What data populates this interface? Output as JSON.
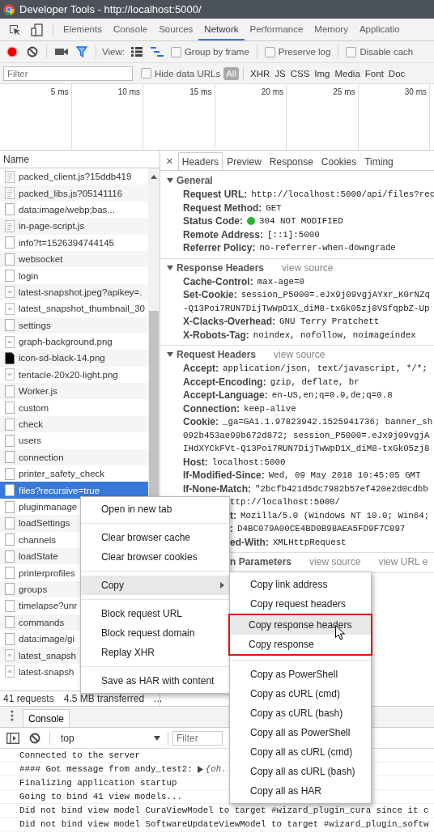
{
  "window": {
    "title": "Developer Tools - http://localhost:5000/"
  },
  "panel_tabs": [
    {
      "label": "Elements",
      "selected": false
    },
    {
      "label": "Console",
      "selected": false
    },
    {
      "label": "Sources",
      "selected": false
    },
    {
      "label": "Network",
      "selected": true
    },
    {
      "label": "Performance",
      "selected": false
    },
    {
      "label": "Memory",
      "selected": false
    },
    {
      "label": "Applicatio",
      "selected": false
    }
  ],
  "toolbar": {
    "recording": true,
    "filter_shown": true,
    "view_label": "View:",
    "large_rows": false,
    "overview": true,
    "options": [
      {
        "label": "Group by frame",
        "checked": false
      },
      {
        "label": "Preserve log",
        "checked": false
      },
      {
        "label": "Disable cach",
        "checked": false
      }
    ]
  },
  "filter_bar": {
    "placeholder": "Filter",
    "hide_data_urls": {
      "label": "Hide data URLs",
      "checked": false
    },
    "types": [
      {
        "label": "All",
        "selected": true
      },
      {
        "label": "XHR",
        "selected": false
      },
      {
        "label": "JS",
        "selected": false
      },
      {
        "label": "CSS",
        "selected": false
      },
      {
        "label": "Img",
        "selected": false
      },
      {
        "label": "Media",
        "selected": false
      },
      {
        "label": "Font",
        "selected": false
      },
      {
        "label": "Doc",
        "selected": false
      }
    ]
  },
  "timeline": {
    "ticks": [
      "5 ms",
      "10 ms",
      "15 ms",
      "20 ms",
      "25 ms",
      "30 ms"
    ]
  },
  "requests": {
    "column": "Name",
    "rows": [
      {
        "name": "packed_client.js?15ddb419",
        "kind": "script",
        "selected": false
      },
      {
        "name": "packed_libs.js?05141116",
        "kind": "script",
        "selected": false
      },
      {
        "name": "data:image/webp;bas...",
        "kind": "blank",
        "selected": false
      },
      {
        "name": "in-page-script.js",
        "kind": "script",
        "selected": false
      },
      {
        "name": "info?t=1526394744145",
        "kind": "blank",
        "selected": false
      },
      {
        "name": "websocket",
        "kind": "blank",
        "selected": false
      },
      {
        "name": "login",
        "kind": "blank",
        "selected": false
      },
      {
        "name": "latest-snapshot.jpeg?apikey=.",
        "kind": "image",
        "selected": false
      },
      {
        "name": "latest_snapshot_thumbnail_30",
        "kind": "image",
        "selected": false
      },
      {
        "name": "settings",
        "kind": "blank",
        "selected": false
      },
      {
        "name": "graph-background.png",
        "kind": "image",
        "selected": false
      },
      {
        "name": "icon-sd-black-14.png",
        "kind": "solid",
        "selected": false
      },
      {
        "name": "tentacle-20x20-light.png",
        "kind": "image",
        "selected": false
      },
      {
        "name": "Worker.js",
        "kind": "blank",
        "selected": false
      },
      {
        "name": "custom",
        "kind": "blank",
        "selected": false
      },
      {
        "name": "check",
        "kind": "blank",
        "selected": false
      },
      {
        "name": "users",
        "kind": "blank",
        "selected": false
      },
      {
        "name": "connection",
        "kind": "blank",
        "selected": false
      },
      {
        "name": "printer_safety_check",
        "kind": "blank",
        "selected": false
      },
      {
        "name": "files?recursive=true",
        "kind": "blank",
        "selected": true
      },
      {
        "name": "pluginmanage",
        "kind": "blank",
        "selected": false
      },
      {
        "name": "loadSettings",
        "kind": "blank",
        "selected": false
      },
      {
        "name": "channels",
        "kind": "blank",
        "selected": false
      },
      {
        "name": "loadState",
        "kind": "blank",
        "selected": false
      },
      {
        "name": "printerprofiles",
        "kind": "blank",
        "selected": false
      },
      {
        "name": "groups",
        "kind": "blank",
        "selected": false
      },
      {
        "name": "timelapse?unr",
        "kind": "blank",
        "selected": false
      },
      {
        "name": "commands",
        "kind": "blank",
        "selected": false
      },
      {
        "name": "data:image/gi",
        "kind": "blank",
        "selected": false
      },
      {
        "name": "latest_snapsh",
        "kind": "image",
        "selected": false
      },
      {
        "name": "latest-snapsh",
        "kind": "image",
        "selected": false
      }
    ]
  },
  "status_bar": [
    "41 requests",
    "4.5 MB transferred",
    "..."
  ],
  "details": {
    "close": "×",
    "tabs": [
      {
        "label": "Headers",
        "selected": true
      },
      {
        "label": "Preview",
        "selected": false
      },
      {
        "label": "Response",
        "selected": false
      },
      {
        "label": "Cookies",
        "selected": false
      },
      {
        "label": "Timing",
        "selected": false
      }
    ],
    "sections": [
      {
        "title": "General",
        "expanded": true,
        "kind": "normal",
        "rows": [
          {
            "name": "Request URL:",
            "value": "http://localhost:5000/api/files?rec"
          },
          {
            "name": "Request Method:",
            "value": "GET"
          },
          {
            "name": "Status Code:",
            "value": "304 NOT MODIFIED",
            "color": "#2bb52b"
          },
          {
            "name": "Remote Address:",
            "value": "[::1]:5000"
          },
          {
            "name": "Referrer Policy:",
            "value": "no-referrer-when-downgrade"
          }
        ]
      },
      {
        "title": "Response Headers",
        "expanded": true,
        "kind": "normal",
        "links": [
          "view source"
        ],
        "rows": [
          {
            "name": "Cache-Control:",
            "value": "max-age=0"
          },
          {
            "name": "Set-Cookie:",
            "value": "session_P5000=.eJx9j09vgjAYxr_K0rNZq",
            "more": [
              "-Q13Poi7RUN7DijTwWpD1X_diM8-txGk05zj8VSfqpbZ-Up"
            ]
          },
          {
            "name": "X-Clacks-Overhead:",
            "value": "GNU Terry Pratchett"
          },
          {
            "name": "X-Robots-Tag:",
            "value": "noindex, nofollow, noimageindex"
          }
        ]
      },
      {
        "title": "Request Headers",
        "expanded": true,
        "kind": "normal",
        "links": [
          "view source"
        ],
        "rows": [
          {
            "name": "Accept:",
            "value": "application/json, text/javascript, */*;"
          },
          {
            "name": "Accept-Encoding:",
            "value": "gzip, deflate, br"
          },
          {
            "name": "Accept-Language:",
            "value": "en-US,en;q=0.9,de;q=0.8"
          },
          {
            "name": "Connection:",
            "value": "keep-alive"
          },
          {
            "name": "Cookie:",
            "value": "_ga=GA1.1.97823942.1525941736; banner_sh",
            "more": [
              "092b453ae99b672d872; session_P5000=.eJx9j09vgjA",
              "IHdXYCkFVt-Q13Poi7RUN7DijTwWpD1X_diM8-txGk05zj8"
            ]
          },
          {
            "name": "Host:",
            "value": "localhost:5000"
          },
          {
            "name": "If-Modified-Since:",
            "value": "Wed, 09 May 2018 10:45:05 GMT"
          },
          {
            "name": "If-None-Match:",
            "value": "\"2bcfb421d5dc7982b57ef420e2d0cdbb"
          },
          {
            "kind": "covered",
            "value": "ttp://localhost:5000/"
          },
          {
            "kind": "covered",
            "name": "t:",
            "value": "Mozilla/5.0 (Windows NT 10.0; Win64;"
          },
          {
            "kind": "covered",
            "name": ":",
            "value": "D4BC079A00CE4BD0B98AEA5FD9F7C897"
          },
          {
            "kind": "covered",
            "name": "ed-With:",
            "value": "XMLHttpRequest"
          }
        ]
      },
      {
        "title": "n Parameters",
        "kind": "covered",
        "links": [
          "view source",
          "view URL e"
        ]
      }
    ]
  },
  "context_menu": {
    "items": [
      {
        "kind": "item",
        "label": "Open in new tab",
        "highlighted": false
      },
      {
        "kind": "separator"
      },
      {
        "kind": "item",
        "label": "Clear browser cache",
        "highlighted": false
      },
      {
        "kind": "item",
        "label": "Clear browser cookies",
        "highlighted": false
      },
      {
        "kind": "separator"
      },
      {
        "kind": "submenu",
        "label": "Copy",
        "highlighted": true
      },
      {
        "kind": "separator"
      },
      {
        "kind": "item",
        "label": "Block request URL",
        "highlighted": false
      },
      {
        "kind": "item",
        "label": "Block request domain",
        "highlighted": false
      },
      {
        "kind": "item",
        "label": "Replay XHR",
        "highlighted": false
      },
      {
        "kind": "separator"
      },
      {
        "kind": "item",
        "label": "Save as HAR with content",
        "highlighted": false
      }
    ]
  },
  "submenu": {
    "items": [
      {
        "kind": "item",
        "label": "Copy link address",
        "highlighted": false,
        "outlined": false
      },
      {
        "kind": "item",
        "label": "Copy request headers",
        "highlighted": false,
        "outlined": false
      },
      {
        "kind": "item",
        "label": "Copy response headers",
        "highlighted": true,
        "outlined": true
      },
      {
        "kind": "item",
        "label": "Copy response",
        "highlighted": false,
        "outlined": true
      },
      {
        "kind": "separator"
      },
      {
        "kind": "item",
        "label": "Copy as PowerShell",
        "highlighted": false,
        "outlined": false
      },
      {
        "kind": "item",
        "label": "Copy as cURL (cmd)",
        "highlighted": false,
        "outlined": false
      },
      {
        "kind": "item",
        "label": "Copy as cURL (bash)",
        "highlighted": false,
        "outlined": false
      },
      {
        "kind": "item",
        "label": "Copy all as PowerShell",
        "highlighted": false,
        "outlined": false
      },
      {
        "kind": "item",
        "label": "Copy all as cURL (cmd)",
        "highlighted": false,
        "outlined": false
      },
      {
        "kind": "item",
        "label": "Copy all as cURL (bash)",
        "highlighted": false,
        "outlined": false
      },
      {
        "kind": "item",
        "label": "Copy all as HAR",
        "highlighted": false,
        "outlined": false
      }
    ]
  },
  "drawer": {
    "tabs": [
      {
        "label": "Console",
        "selected": true
      }
    ],
    "context": "top",
    "filter_placeholder": "Filter",
    "messages": [
      {
        "text": "Connected to the server"
      },
      {
        "text": "#### Got message from andy_test2:",
        "object": "{oh."
      },
      {
        "text": "Finalizing application startup"
      },
      {
        "text": "Going to bind 41 view models..."
      },
      {
        "text": "Did not bind view model CuraViewModel to target #wizard_plugin_cura since it c"
      },
      {
        "text": "Did not bind view model SoftwareUpdateViewModel to target #wizard_plugin_softw"
      }
    ]
  }
}
